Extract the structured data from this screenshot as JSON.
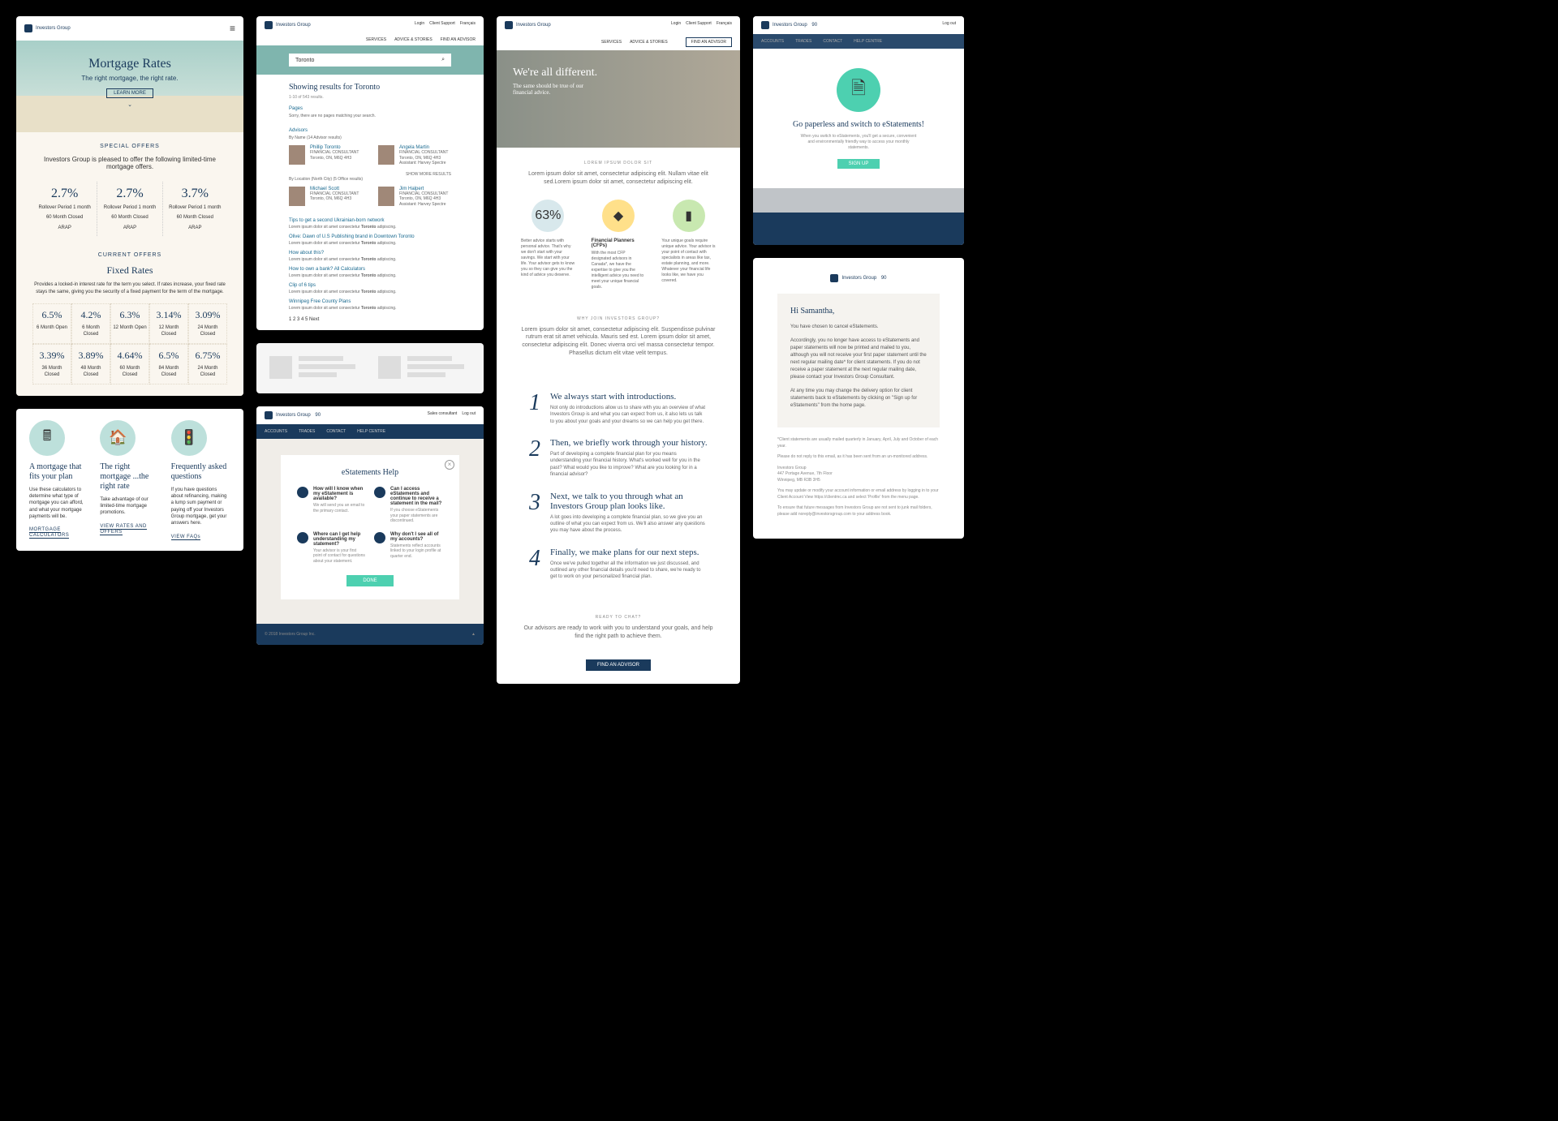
{
  "brand": "Investors Group",
  "a": {
    "hero_title": "Mortgage Rates",
    "hero_sub": "The right mortgage, the right rate.",
    "learn": "LEARN MORE",
    "offers_h": "SPECIAL OFFERS",
    "offers_sub": "Investors Group is pleased to offer the following limited-time mortgage offers.",
    "so": [
      {
        "pct": "2.7%",
        "l1": "Rollover Period 1 month",
        "l2": "60 Month Closed",
        "l3": "ARAP"
      },
      {
        "pct": "2.7%",
        "l1": "Rollover Period 1 month",
        "l2": "60 Month Closed",
        "l3": "ARAP"
      },
      {
        "pct": "3.7%",
        "l1": "Rollover Period 1 month",
        "l2": "60 Month Closed",
        "l3": "ARAP"
      }
    ],
    "cur_h": "CURRENT OFFERS",
    "fixed_h": "Fixed Rates",
    "fixed_desc": "Provides a locked-in interest rate for the term you select. If rates increase, your fixed rate stays the same, giving you the security of a fixed payment for the term of the mortgage.",
    "grid": [
      {
        "pct": "6.5%",
        "t": "6 Month Open"
      },
      {
        "pct": "4.2%",
        "t": "6 Month Closed"
      },
      {
        "pct": "6.3%",
        "t": "12 Month Open"
      },
      {
        "pct": "3.14%",
        "t": "12 Month Closed"
      },
      {
        "pct": "3.09%",
        "t": "24 Month Closed"
      },
      {
        "pct": "3.39%",
        "t": "36 Month Closed"
      },
      {
        "pct": "3.89%",
        "t": "48 Month Closed"
      },
      {
        "pct": "4.64%",
        "t": "60 Month Closed"
      },
      {
        "pct": "6.5%",
        "t": "84 Month Closed"
      },
      {
        "pct": "6.75%",
        "t": "24 Month Closed"
      }
    ]
  },
  "b": {
    "cols": [
      {
        "title": "A mortgage that fits your plan",
        "txt": "Use these calculators to determine what type of mortgage you can afford, and what your mortgage payments will be.",
        "link": "MORTGAGE CALCULATORS"
      },
      {
        "title": "The right mortgage ...the right rate",
        "txt": "Take advantage of our limited-time mortgage promotions.",
        "link": "VIEW RATES AND OFFERS"
      },
      {
        "title": "Frequently asked questions",
        "txt": "If you have questions about refinancing, making a lump sum payment or paying off your Investors Group mortgage, get your answers here.",
        "link": "VIEW FAQs"
      }
    ]
  },
  "c": {
    "top": [
      "Login",
      "Client Support",
      "Français"
    ],
    "nav": [
      "SERVICES",
      "ADVICE & STORIES",
      "FIND AN ADVISOR"
    ],
    "query": "Toronto",
    "results_h": "Showing results for Toronto",
    "count": "1-10 of 543 results.",
    "pages_h": "Pages",
    "pages_s": "Sorry, there are no pages matching your search.",
    "adv_h": "Advisors",
    "adv_by": "By Name (14 Advisor results)",
    "adv_more": "SHOW MORE RESULTS",
    "adv_loc": "By Location (North City) (5 Office results)",
    "advisors": [
      {
        "name": "Phillip Toronto",
        "role": "FINANCIAL CONSULTANT",
        "loc": "Toronto, ON, M6Q 4H3"
      },
      {
        "name": "Angela Martin",
        "role": "FINANCIAL CONSULTANT",
        "loc": "Toronto, ON, M6Q 4H3",
        "assist": "Assistant: Harvey Spectre"
      },
      {
        "name": "Michael Scott",
        "role": "FINANCIAL CONSULTANT",
        "loc": "Toronto, ON, M6Q 4H3"
      },
      {
        "name": "Jim Halpert",
        "role": "FINANCIAL CONSULTANT",
        "loc": "Toronto, ON, M6Q 4H3",
        "assist": "Assistant: Harvey Spectre"
      }
    ],
    "links": [
      "Tips to get a second Ukrainian-born network",
      "Olive: Dawn of U.S Publishing brand in Downtown Toronto",
      "How about this?",
      "How to own a bank? All Calculators",
      "Clip of 6 tips",
      "Winnipeg Free County Plans"
    ],
    "pag": "1  2  3  4  5   Next"
  },
  "e": {
    "top": [
      "Sales consultant",
      "Log out"
    ],
    "nav": [
      "ACCOUNTS",
      "TRADES",
      "CONTACT",
      "HELP CENTRE"
    ],
    "title": "eStatements Help",
    "faqs": [
      {
        "q": "How will I know when my eStatement is available?",
        "a": "We will send you an email to the primary contact."
      },
      {
        "q": "Can I access eStatements and continue to receive a statement in the mail?",
        "a": "If you choose eStatements your paper statements are discontinued."
      },
      {
        "q": "Where can I get help understanding my statement?",
        "a": "Your advisor is your first point of contact for questions about your statement."
      },
      {
        "q": "Why don't I see all of my accounts?",
        "a": "Statements reflect accounts linked to your login profile at quarter end."
      }
    ],
    "btn": "DONE"
  },
  "f": {
    "top": [
      "Login",
      "Client Support",
      "Français"
    ],
    "nav": [
      "SERVICES",
      "ADVICE & STORIES"
    ],
    "cta": "FIND AN ADVISOR",
    "hero_h": "We're all different.",
    "hero_p": "The same should be true of our financial advice.",
    "s1_h": "LOREM IPSUM DOLOR SIT",
    "s1_t": "Lorem ipsum dolor sit amet, consectetur adipiscing elit. Nullam vitae elit sed.Lorem ipsum dolor sit amet, consectetur adipiscing elit.",
    "icons": [
      {
        "label": "63%",
        "txt": "Better advice starts with personal advice. That's why we don't start with your savings. We start with your life. Your advisor gets to know you so they can give you the kind of advice you deserve."
      },
      {
        "label": "◆",
        "title": "Financial Planners (CFPs)",
        "txt": "With the most CFP designated advisors in Canada*, we have the expertise to give you the intelligent advice you need to meet your unique financial goals."
      },
      {
        "label": "▮",
        "txt": "Your unique goals require unique advice. Your advisor is your point of contact with specialists in areas like tax, estate planning, and more. Whatever your financial life looks like, we have you covered."
      }
    ],
    "why_h": "WHY JOIN INVESTORS GROUP?",
    "why_t": "Lorem ipsum dolor sit amet, consectetur adipiscing elit. Suspendisse pulvinar rutrum erat sit amet vehicula. Mauris sed est. Lorem ipsum dolor sit amet, consectetur adipiscing elit. Donec viverra orci vel massa consectetur tempor. Phasellus dictum elit vitae velit tempus.",
    "steps": [
      {
        "n": "1",
        "h": "We always start with introductions.",
        "t": "Not only do introductions allow us to share with you an overview of what Investors Group is and what you can expect from us, it also lets us talk to you about your goals and your dreams so we can help you get there."
      },
      {
        "n": "2",
        "h": "Then, we briefly work through your history.",
        "t": "Part of developing a complete financial plan for you means understanding your financial history. What's worked well for you in the past? What would you like to improve? What are you looking for in a financial advisor?"
      },
      {
        "n": "3",
        "h": "Next, we talk to you through what an Investors Group plan looks like.",
        "t": "A lot goes into developing a complete financial plan, so we give you an outline of what you can expect from us. We'll also answer any questions you may have about the process."
      },
      {
        "n": "4",
        "h": "Finally, we make plans for our next steps.",
        "t": "Once we've pulled together all the information we just discussed, and outlined any other financial details you'd need to share, we're ready to get to work on your personalized financial plan."
      }
    ],
    "ready_h": "READY TO CHAT?",
    "ready_t": "Our advisors are ready to work with you to understand your goals, and help find the right path to achieve them.",
    "ready_btn": "FIND AN ADVISOR"
  },
  "g": {
    "nav": [
      "ACCOUNTS",
      "TRADES",
      "CONTACT",
      "HELP CENTRE"
    ],
    "h": "Go paperless and switch to eStatements!",
    "t": "When you switch to eStatements, you'll get a secure, convenient and environmentally friendly way to access your monthly statements.",
    "btn": "SIGN UP"
  },
  "h": {
    "greeting": "Hi Samantha,",
    "p1": "You have chosen to cancel eStatements.",
    "p2": "Accordingly, you no longer have access to eStatements and paper statements will now be printed and mailed to you, although you will not receive your first paper statement until the next regular mailing date* for client statements. If you do not receive a paper statement at the next regular mailing date, please contact your Investors Group Consultant.",
    "p3": "At any time you may change the delivery option for client statements back to eStatements by clicking on \"Sign up for eStatements\" from the home page.",
    "foot": [
      "*Client statements are usually mailed quarterly in January, April, July and October of each year.",
      "Please do not reply to this email, as it has been sent from an un-monitored address.",
      "Investors Group\n447 Portage Avenue, 7th Floor\nWinnipeg, MB R3B 3H5",
      "You may update or modify your account information or email address by logging in to your Client Account View https://clientmc.ca and select 'Profile' from the menu page.",
      "To ensure that future messages from Investors Group are not sent to junk mail folders, please add noreply@investorsgroup.com to your address book."
    ]
  }
}
